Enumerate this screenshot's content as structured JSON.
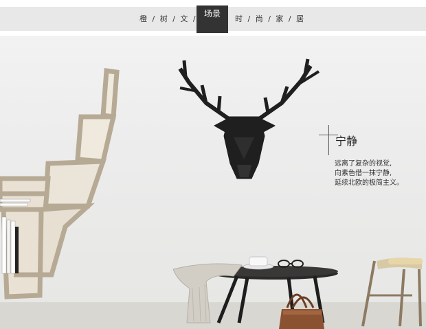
{
  "banner": {
    "left_tabs": "橙 / 树 / 文 / 创",
    "active_tab": "场景",
    "right_tabs": "时 / 尚 / 家 / 居"
  },
  "caption": {
    "title": "宁静",
    "lines": [
      "远离了复杂的视觉,",
      "向素色借一抹宁静,",
      "延续北欧的极简主义。"
    ]
  }
}
